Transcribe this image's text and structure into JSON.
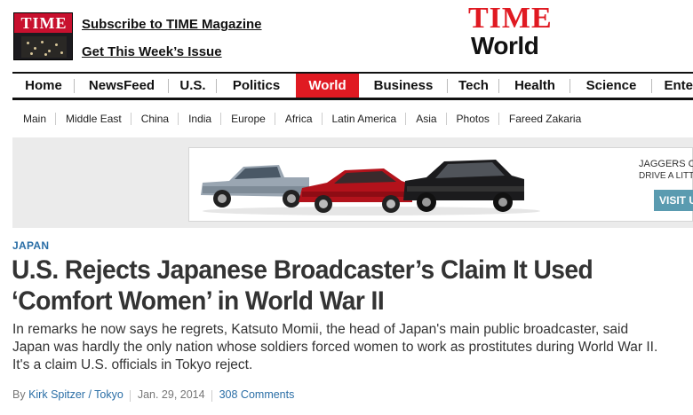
{
  "header": {
    "cover_masthead": "TIME",
    "subscribe_link": "Subscribe to TIME Magazine",
    "issue_link": "Get This Week’s Issue",
    "logo_brand": "TIME",
    "logo_section": "World"
  },
  "nav": {
    "items": [
      {
        "label": "Home"
      },
      {
        "label": "NewsFeed"
      },
      {
        "label": "U.S."
      },
      {
        "label": "Politics"
      },
      {
        "label": "World",
        "active": true
      },
      {
        "label": "Business"
      },
      {
        "label": "Tech"
      },
      {
        "label": "Health"
      },
      {
        "label": "Science"
      },
      {
        "label": "Ente"
      }
    ]
  },
  "subnav": {
    "items": [
      {
        "label": "Main"
      },
      {
        "label": "Middle East"
      },
      {
        "label": "China"
      },
      {
        "label": "India"
      },
      {
        "label": "Europe"
      },
      {
        "label": "Africa"
      },
      {
        "label": "Latin America"
      },
      {
        "label": "Asia"
      },
      {
        "label": "Photos"
      },
      {
        "label": "Fareed Zakaria"
      }
    ]
  },
  "ad": {
    "line1": "JAGGERS C",
    "line2": "DRIVE A LITTL",
    "button": "VISIT U"
  },
  "article": {
    "kicker": "JAPAN",
    "headline": "U.S. Rejects Japanese Broadcaster’s Claim It Used ‘Comfort Women’ in World War II",
    "dek": "In remarks he now says he regrets, Katsuto Momii, the head of Japan's main public broadcaster, said Japan was hardly the only nation whose soldiers forced women to work as prostitutes during World War II. It's a claim U.S. officials in Tokyo reject.",
    "byline_prefix": "By",
    "author": "Kirk Spitzer / Tokyo",
    "date": "Jan. 29, 2014",
    "comments": "308 Comments"
  },
  "colors": {
    "brand_red": "#e01a22",
    "link_blue": "#2a6ea6",
    "ad_button": "#5a9bb0"
  }
}
